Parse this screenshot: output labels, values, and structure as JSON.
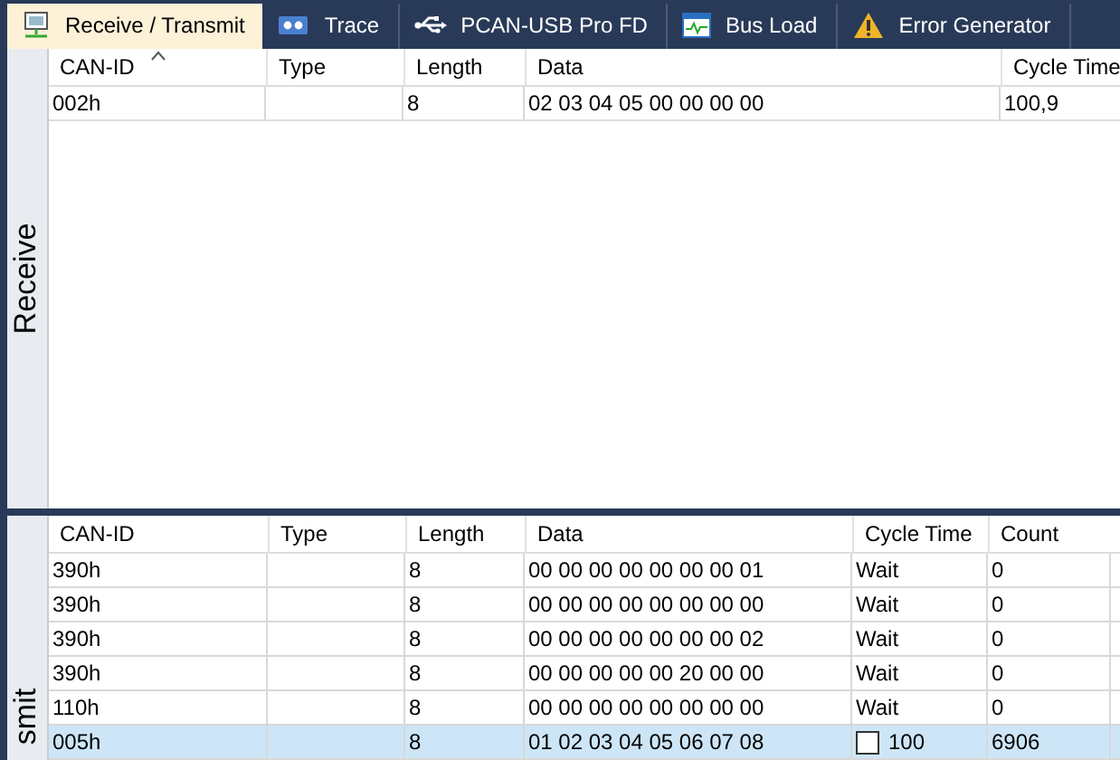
{
  "tabs": [
    {
      "label": "Receive / Transmit",
      "selected": true,
      "kind": "network"
    },
    {
      "label": "Trace",
      "selected": false,
      "kind": "trace"
    },
    {
      "label": "PCAN-USB Pro FD",
      "selected": false,
      "kind": "usb"
    },
    {
      "label": "Bus Load",
      "selected": false,
      "kind": "busload"
    },
    {
      "label": "Error Generator",
      "selected": false,
      "kind": "warning"
    }
  ],
  "receive": {
    "label": "Receive",
    "columns": [
      {
        "label": "CAN-ID",
        "sorted": true
      },
      {
        "label": "Type",
        "sorted": false
      },
      {
        "label": "Length",
        "sorted": false
      },
      {
        "label": "Data",
        "sorted": false
      },
      {
        "label": "Cycle Time",
        "sorted": false
      }
    ],
    "rows": [
      {
        "cells": [
          "002h",
          "",
          "8",
          "02 03 04 05 00 00 00 00",
          "100,9"
        ]
      }
    ]
  },
  "transmit": {
    "label": "smit",
    "columns": [
      "CAN-ID",
      "Type",
      "Length",
      "Data",
      "Cycle Time",
      "Count"
    ],
    "rows": [
      {
        "cells": [
          "390h",
          "",
          "8",
          "00 00 00 00 00 00 00 01",
          "Wait",
          "0"
        ],
        "selected": false,
        "kind": "wait"
      },
      {
        "cells": [
          "390h",
          "",
          "8",
          "00 00 00 00 00 00 00 00",
          "Wait",
          "0"
        ],
        "selected": false,
        "kind": "wait"
      },
      {
        "cells": [
          "390h",
          "",
          "8",
          "00 00 00 00 00 00 00 02",
          "Wait",
          "0"
        ],
        "selected": false,
        "kind": "wait"
      },
      {
        "cells": [
          "390h",
          "",
          "8",
          "00 00 00 00 00 20 00 00",
          "Wait",
          "0"
        ],
        "selected": false,
        "kind": "wait"
      },
      {
        "cells": [
          "110h",
          "",
          "8",
          "00 00 00 00 00 00 00 00",
          "Wait",
          "0"
        ],
        "selected": false,
        "kind": "wait"
      },
      {
        "cells": [
          "005h",
          "",
          "8",
          "01 02 03 04 05 06 07 08",
          "100",
          "6906"
        ],
        "selected": true,
        "kind": "cyclic",
        "checked": false
      }
    ]
  }
}
